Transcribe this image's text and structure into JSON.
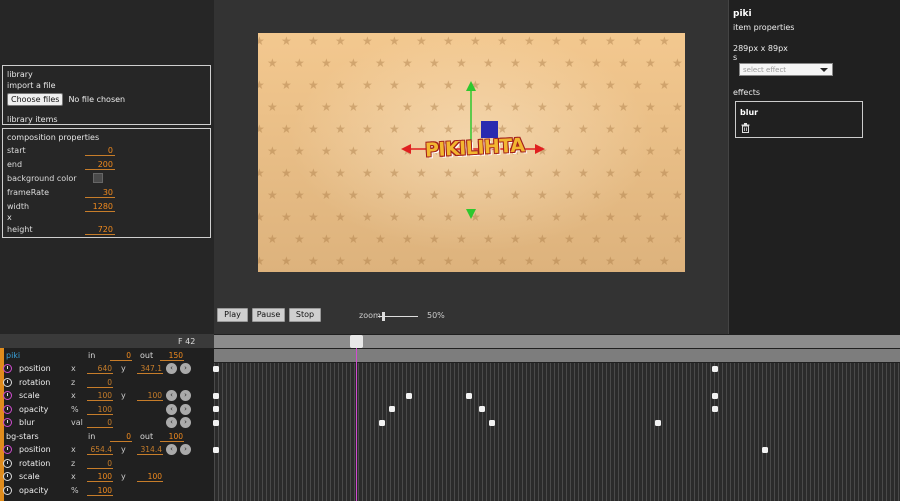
{
  "library": {
    "title": "library",
    "import_label": "import a file",
    "choose_button": "Choose files",
    "no_file": "No file chosen",
    "items_label": "library items"
  },
  "composition": {
    "title": "composition properties",
    "start_label": "start",
    "start": "0",
    "end_label": "end",
    "end": "200",
    "bg_label": "background color",
    "framerate_label": "frameRate",
    "framerate": "30",
    "width_label": "width",
    "width": "1280",
    "x_label": "x",
    "height_label": "height",
    "height": "720"
  },
  "canvas": {
    "text": "PIKILIHTA",
    "bg_color": "#f3c88f"
  },
  "controls": {
    "play": "Play",
    "pause": "Pause",
    "stop": "Stop",
    "zoom_label": "zoom",
    "zoom_value": "50%",
    "zoom_level": 0.1
  },
  "item": {
    "name": "piki",
    "title": "item properties",
    "size": "289px x 89px",
    "s_label": "s",
    "select_placeholder": "select effect",
    "effects_label": "effects",
    "effect_name": "blur",
    "trash_icon": "trash-icon"
  },
  "timeline": {
    "frame": "F 42",
    "current_frame": 42,
    "total_frames": 200,
    "layers": [
      {
        "name": "piki",
        "in_label": "in",
        "in": "0",
        "out_label": "out",
        "out": "150",
        "props": [
          {
            "label": "position",
            "a": "x",
            "av": "640",
            "b": "y",
            "bv": "347.1",
            "buttons": true
          },
          {
            "label": "rotation",
            "a": "z",
            "av": "0",
            "buttons": false
          },
          {
            "label": "scale",
            "a": "x",
            "av": "100",
            "b": "y",
            "bv": "100",
            "buttons": true
          },
          {
            "label": "opacity",
            "a": "%",
            "av": "100",
            "buttons": true
          },
          {
            "label": "blur",
            "a": "val",
            "av": "0",
            "buttons": true
          }
        ]
      },
      {
        "name": "bg-stars",
        "in_label": "in",
        "in": "0",
        "out_label": "out",
        "out": "100",
        "props": [
          {
            "label": "position",
            "a": "x",
            "av": "654.4",
            "b": "y",
            "bv": "314.4",
            "buttons": true
          },
          {
            "label": "rotation",
            "a": "z",
            "av": "0",
            "buttons": false
          },
          {
            "label": "scale",
            "a": "x",
            "av": "100",
            "b": "y",
            "bv": "100",
            "buttons": false
          },
          {
            "label": "opacity",
            "a": "%",
            "av": "100",
            "buttons": false
          }
        ]
      }
    ],
    "keyframes": {
      "piki_position": [
        0,
        150
      ],
      "piki_scale": [
        0,
        58,
        76,
        150
      ],
      "piki_opacity": [
        0,
        53,
        80,
        150
      ],
      "piki_blur": [
        0,
        50,
        83,
        133
      ],
      "bgstars_position": [
        0,
        165
      ]
    }
  },
  "colors": {
    "accent": "#f08a1e",
    "playhead": "#d04cd0",
    "layer_name": "#3aa0d8"
  }
}
